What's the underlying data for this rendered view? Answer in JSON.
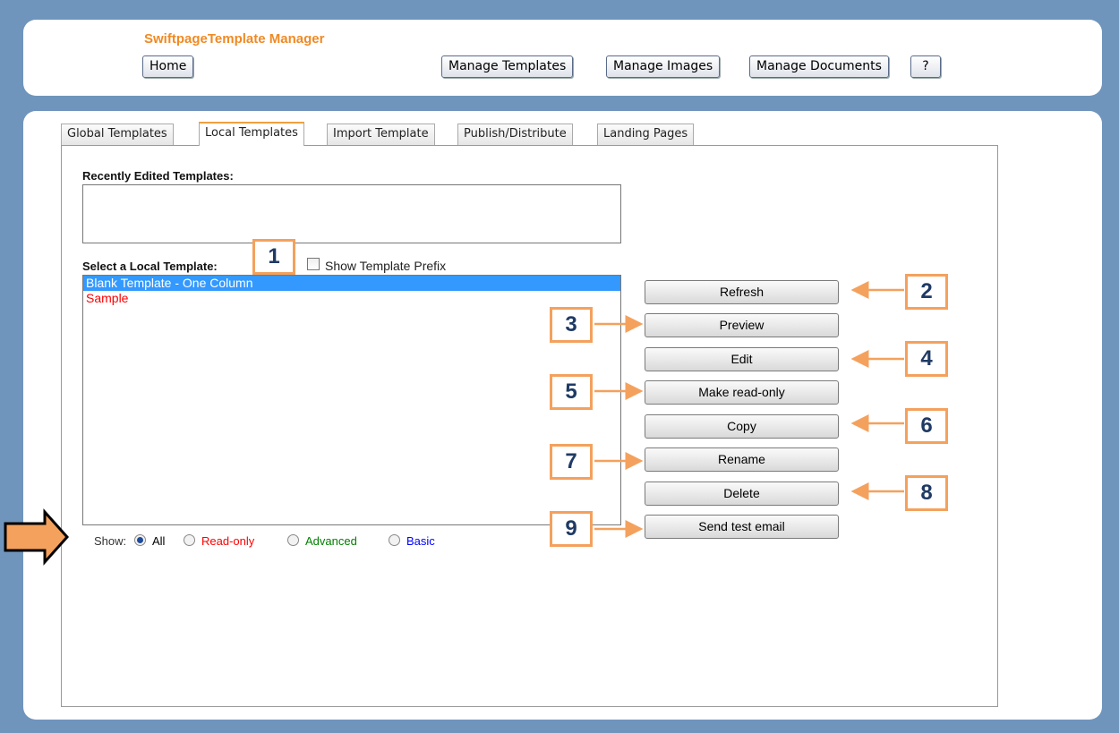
{
  "header": {
    "app_title": "SwiftpageTemplate Manager",
    "home": "Home",
    "manage_templates": "Manage Templates",
    "manage_images": "Manage Images",
    "manage_documents": "Manage Documents",
    "help": "?"
  },
  "tabs": [
    {
      "label": "Global Templates"
    },
    {
      "label": "Local Templates",
      "active": true
    },
    {
      "label": "Import Template"
    },
    {
      "label": "Publish/Distribute"
    },
    {
      "label": "Landing Pages"
    }
  ],
  "recent": {
    "label": "Recently Edited Templates:"
  },
  "select": {
    "label": "Select a Local Template:",
    "show_prefix_label": "Show Template Prefix",
    "show_prefix_checked": false
  },
  "templates": [
    {
      "name": "Blank Template - One Column",
      "color": "#000000",
      "selected": true
    },
    {
      "name": "Sample",
      "color": "#ff0000",
      "selected": false
    }
  ],
  "filter": {
    "show_label": "Show:",
    "options": [
      {
        "label": "All",
        "color": "#000000",
        "checked": true
      },
      {
        "label": "Read-only",
        "color": "#ff0000",
        "checked": false
      },
      {
        "label": "Advanced",
        "color": "#008000",
        "checked": false
      },
      {
        "label": "Basic",
        "color": "#0000ff",
        "checked": false
      }
    ]
  },
  "actions": [
    "Refresh",
    "Preview",
    "Edit",
    "Make read-only",
    "Copy",
    "Rename",
    "Delete",
    "Send test email"
  ],
  "callouts": [
    "1",
    "2",
    "3",
    "4",
    "5",
    "6",
    "7",
    "8",
    "9"
  ],
  "colors": {
    "accent": "#f08a24",
    "callout_border": "#f4a15d",
    "callout_text": "#1f3a64",
    "background": "#6f95bd",
    "selection": "#3399ff"
  }
}
